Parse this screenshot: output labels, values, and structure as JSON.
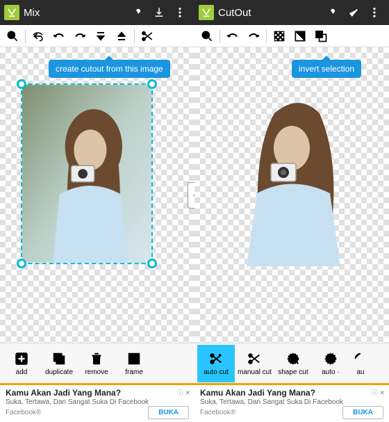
{
  "left": {
    "title": "Mix",
    "tooltip": "create cutout from this image",
    "bottom": [
      {
        "label": "add"
      },
      {
        "label": "duplicate"
      },
      {
        "label": "remove"
      },
      {
        "label": "frame"
      }
    ],
    "ad": {
      "title": "Kamu Akan Jadi Yang Mana?",
      "sub": "Suka, Tertawa, Dan Sangat Suka Di Facebook",
      "site": "Facebook®",
      "cta": "BUKA",
      "badge": "ⓘ"
    }
  },
  "right": {
    "title": "CutOut",
    "tooltip": "invert selection",
    "bottom": [
      {
        "label": "auto cut",
        "selected": true
      },
      {
        "label": "manual cut"
      },
      {
        "label": "shape cut"
      },
      {
        "label": "auto ·"
      },
      {
        "label": "au"
      }
    ],
    "ad": {
      "title": "Kamu Akan Jadi Yang Mana?",
      "sub": "Suka, Tertawa, Dan Sangat Suka Di Facebook",
      "site": "Facebook®",
      "cta": "BUKA",
      "badge": "ⓘ"
    }
  }
}
